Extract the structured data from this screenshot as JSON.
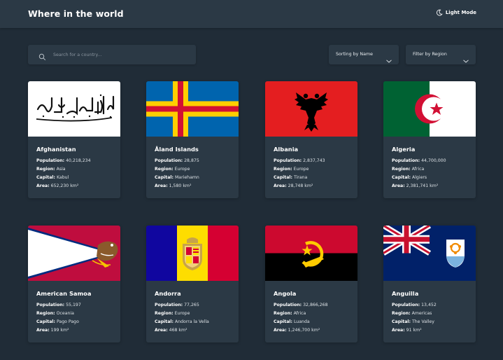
{
  "header": {
    "title": "Where in the world",
    "mode_label": "Light Mode",
    "mode_icon": "moon-icon"
  },
  "search": {
    "placeholder": "Search for a country...",
    "icon": "search-icon"
  },
  "sort": {
    "label": "Sorting by Name",
    "icon": "chevron-down-icon"
  },
  "filter": {
    "label": "Filter by Region",
    "icon": "chevron-down-icon"
  },
  "labels": {
    "population": "Population:",
    "region": "Region:",
    "capital": "Capital:",
    "area": "Area:"
  },
  "colors": {
    "background": "#202c37",
    "surface": "#2b3945",
    "text": "#ffffff"
  },
  "countries": [
    {
      "name": "Afghanistan",
      "population": "40,218,234",
      "region": "Asia",
      "capital": "Kabul",
      "area": "652,230 km²"
    },
    {
      "name": "Åland Islands",
      "population": "28,875",
      "region": "Europe",
      "capital": "Mariehamn",
      "area": "1,580 km²"
    },
    {
      "name": "Albania",
      "population": "2,837,743",
      "region": "Europe",
      "capital": "Tirana",
      "area": "28,748 km²"
    },
    {
      "name": "Algeria",
      "population": "44,700,000",
      "region": "Africa",
      "capital": "Algiers",
      "area": "2,381,741 km²"
    },
    {
      "name": "American Samoa",
      "population": "55,197",
      "region": "Oceania",
      "capital": "Pago Pago",
      "area": "199 km²"
    },
    {
      "name": "Andorra",
      "population": "77,265",
      "region": "Europe",
      "capital": "Andorra la Vella",
      "area": "468 km²"
    },
    {
      "name": "Angola",
      "population": "32,866,268",
      "region": "Africa",
      "capital": "Luanda",
      "area": "1,246,700 km²"
    },
    {
      "name": "Anguilla",
      "population": "13,452",
      "region": "Americas",
      "capital": "The Valley",
      "area": "91 km²"
    }
  ]
}
